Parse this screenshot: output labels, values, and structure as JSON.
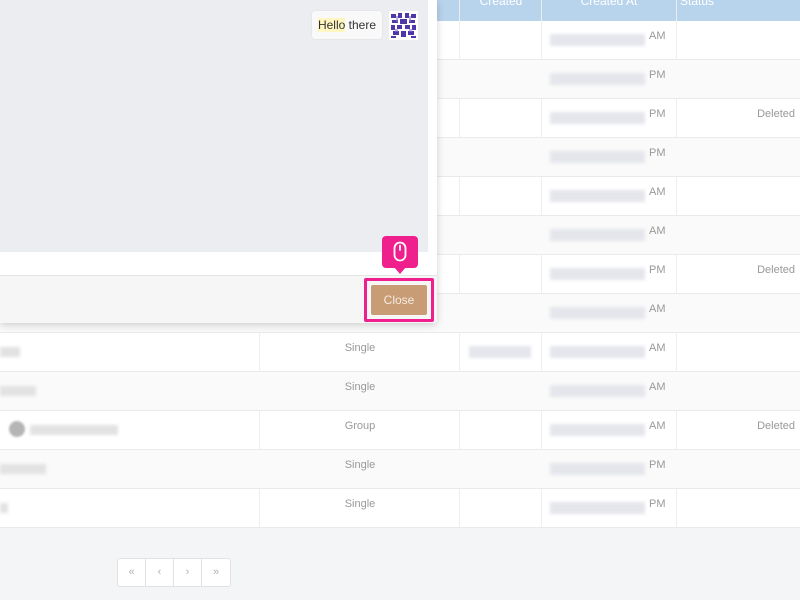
{
  "table": {
    "headers": {
      "created": "Created",
      "created_at": "Created At",
      "status": "Status"
    },
    "rows": [
      {
        "type": "",
        "at_suffix": "AM",
        "status": ""
      },
      {
        "type": "",
        "at_suffix": "PM",
        "status": ""
      },
      {
        "type": "",
        "at_suffix": "PM",
        "status": "Deleted"
      },
      {
        "type": "",
        "at_suffix": "PM",
        "status": ""
      },
      {
        "type": "",
        "at_suffix": "AM",
        "status": ""
      },
      {
        "type": "",
        "at_suffix": "AM",
        "status": ""
      },
      {
        "type": "",
        "at_suffix": "PM",
        "status": "Deleted"
      },
      {
        "type": "",
        "at_suffix": "AM",
        "status": ""
      },
      {
        "type": "Single",
        "at_suffix": "AM",
        "status": ""
      },
      {
        "type": "Single",
        "at_suffix": "AM",
        "status": ""
      },
      {
        "type": "Group",
        "at_suffix": "AM",
        "status": "Deleted"
      },
      {
        "type": "Single",
        "at_suffix": "PM",
        "status": ""
      },
      {
        "type": "Single",
        "at_suffix": "PM",
        "status": ""
      }
    ]
  },
  "pagination": {
    "first": "«",
    "prev": "‹",
    "next": "›",
    "last": "»"
  },
  "modal": {
    "message_highlight": "Hello",
    "message_rest": " there",
    "close_label": "Close"
  },
  "colors": {
    "accent_pink": "#ef1f8e",
    "close_button": "#c89c74",
    "header_blue": "#b8d3ec"
  },
  "icons": {
    "click_marker": "mouse-icon",
    "chat_avatar": "identicon"
  }
}
